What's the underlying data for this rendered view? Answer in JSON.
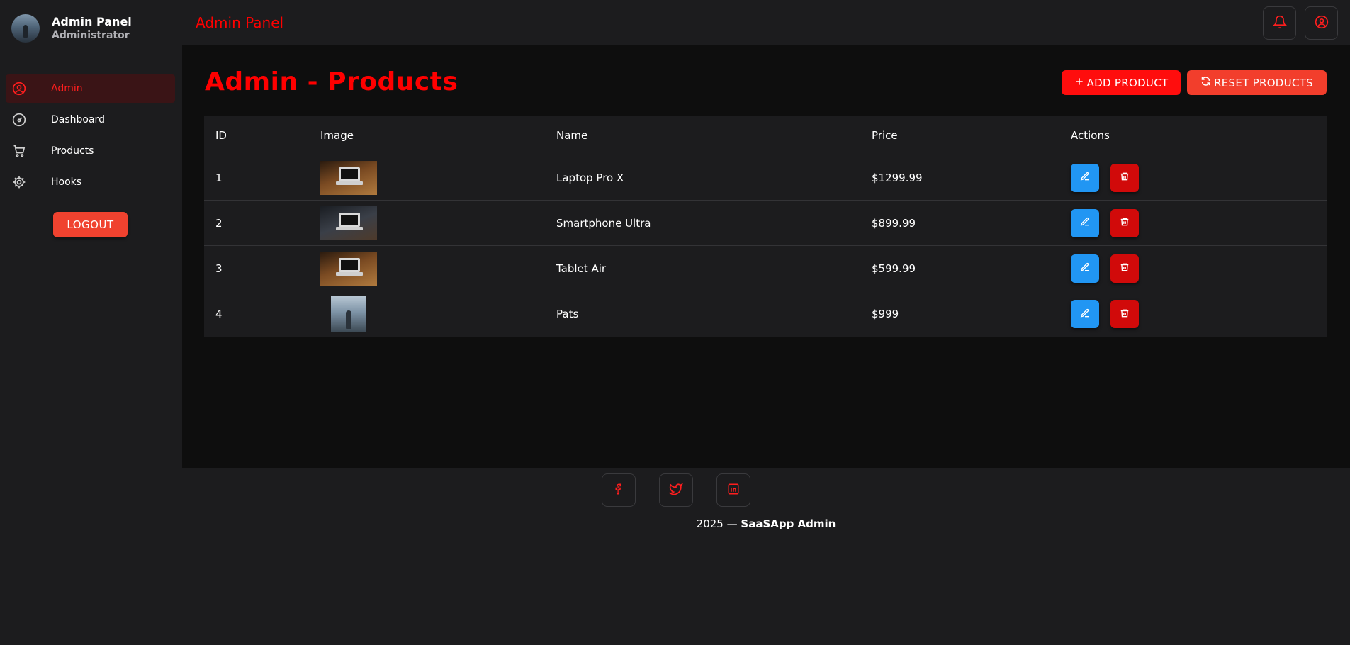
{
  "sidebar": {
    "title": "Admin Panel",
    "subtitle": "Administrator",
    "items": [
      {
        "label": "Admin",
        "icon": "user-circle-icon",
        "active": true
      },
      {
        "label": "Dashboard",
        "icon": "gauge-icon",
        "active": false
      },
      {
        "label": "Products",
        "icon": "cart-icon",
        "active": false
      },
      {
        "label": "Hooks",
        "icon": "gear-icon",
        "active": false
      }
    ],
    "logout_label": "LOGOUT"
  },
  "topbar": {
    "title": "Admin Panel",
    "icons": [
      "bell-icon",
      "user-circle-icon"
    ]
  },
  "main": {
    "page_title": "Admin - Products",
    "add_label": "ADD PRODUCT",
    "reset_label": "RESET PRODUCTS",
    "table": {
      "columns": [
        "ID",
        "Image",
        "Name",
        "Price",
        "Actions"
      ],
      "rows": [
        {
          "id": "1",
          "name": "Laptop Pro X",
          "price": "$1299.99",
          "image": "laptop-on-desk-photo"
        },
        {
          "id": "2",
          "name": "Smartphone Ultra",
          "price": "$899.99",
          "image": "person-at-laptop-photo"
        },
        {
          "id": "3",
          "name": "Tablet Air",
          "price": "$599.99",
          "image": "laptop-on-wooden-table-photo"
        },
        {
          "id": "4",
          "name": "Pats",
          "price": "$999",
          "image": "person-standing-outdoors-photo"
        }
      ]
    }
  },
  "footer": {
    "socials": [
      "facebook-icon",
      "twitter-icon",
      "linkedin-icon"
    ],
    "copyright_prefix": "2025 —",
    "copyright_brand": "SaaSApp Admin"
  },
  "colors": {
    "accent": "#ff0000",
    "edit": "#2196f3",
    "delete": "#d10a0a",
    "active_nav_bg": "#3a1416",
    "sidebar_bg": "#1c1c1e",
    "main_bg": "#0e0e0e"
  }
}
